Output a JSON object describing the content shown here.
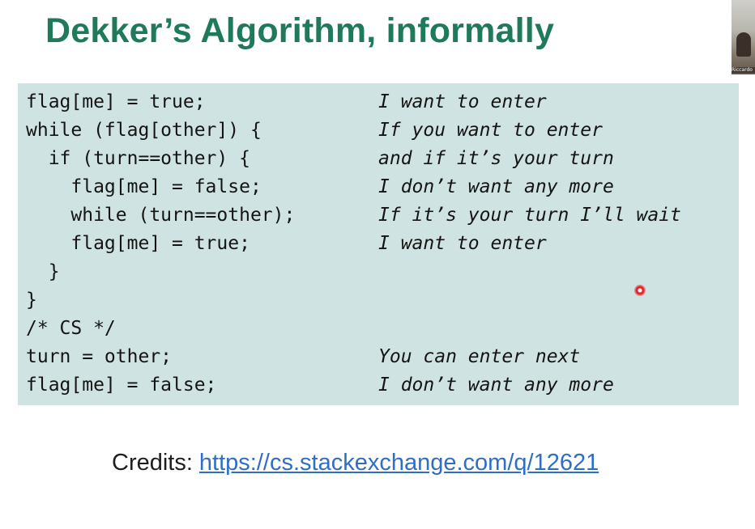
{
  "slide": {
    "title": "Dekker’s Algorithm, informally",
    "lines": [
      {
        "code": "flag[me] = true;",
        "comment": "I want to enter"
      },
      {
        "code": "while (flag[other]) {",
        "comment": "If you want to enter"
      },
      {
        "code": "  if (turn==other) {",
        "comment": "and if it’s your turn"
      },
      {
        "code": "    flag[me] = false;",
        "comment": "I don’t want any more"
      },
      {
        "code": "    while (turn==other);",
        "comment": "If it’s your turn I’ll wait"
      },
      {
        "code": "    flag[me] = true;",
        "comment": "I want to enter"
      },
      {
        "code": "  }",
        "comment": ""
      },
      {
        "code": "}",
        "comment": ""
      },
      {
        "code": "/* CS */",
        "comment": ""
      },
      {
        "code": "turn = other;",
        "comment": "You can enter next"
      },
      {
        "code": "flag[me] = false;",
        "comment": "I don’t want any more"
      }
    ],
    "credits_label": "Credits:",
    "credits_link": "https://cs.stackexchange.com/q/12621"
  },
  "webcam": {
    "participant_name": "Riccardo"
  },
  "pointer": {
    "icon": "laser-pointer-icon",
    "color": "#e5252a"
  },
  "colors": {
    "title": "#1f7a5c",
    "code_background": "#d0e3e3",
    "link": "#2f6ec4"
  }
}
